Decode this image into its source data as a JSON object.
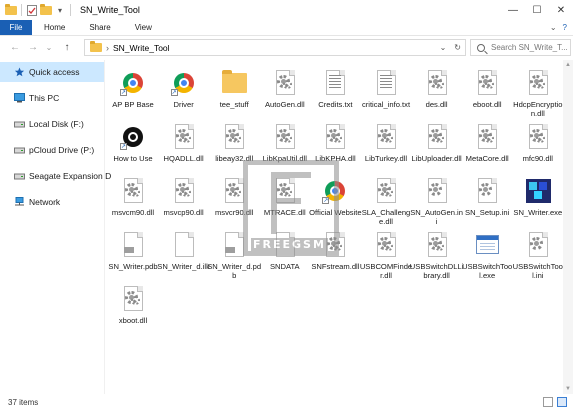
{
  "window": {
    "title": "SN_Write_Tool",
    "minimize": "—",
    "maximize": "☐",
    "close": "✕"
  },
  "ribbon": {
    "file": "File",
    "tabs": [
      "Home",
      "Share",
      "View"
    ],
    "expand": "⌄",
    "help": "?"
  },
  "address": {
    "back": "←",
    "forward": "→",
    "recent": "⌄",
    "up": "↑",
    "chevron": "›",
    "path": "SN_Write_Tool",
    "dropdown": "⌄",
    "refresh": "↻",
    "search_placeholder": "Search SN_Write_T..."
  },
  "nav": {
    "items": [
      {
        "label": "Quick access",
        "icon": "star-icon"
      },
      {
        "label": "This PC",
        "icon": "computer-icon"
      },
      {
        "label": "Local Disk (F:)",
        "icon": "drive-icon"
      },
      {
        "label": "pCloud Drive (P:)",
        "icon": "drive-icon"
      },
      {
        "label": "Seagate Expansion D",
        "icon": "drive-icon"
      },
      {
        "label": "Network",
        "icon": "network-icon"
      }
    ]
  },
  "files": [
    {
      "name": "AP BP Base",
      "icon": "chrome-shortcut-icon"
    },
    {
      "name": "Driver",
      "icon": "chrome-shortcut-icon"
    },
    {
      "name": "tee_stuff",
      "icon": "folder-icon"
    },
    {
      "name": "AutoGen.dll",
      "icon": "dll-icon"
    },
    {
      "name": "Credits.txt",
      "icon": "txt-icon"
    },
    {
      "name": "critical_info.txt",
      "icon": "txt-icon"
    },
    {
      "name": "des.dll",
      "icon": "dll-icon"
    },
    {
      "name": "eboot.dll",
      "icon": "dll-icon"
    },
    {
      "name": "HdcpEncryption.dll",
      "icon": "dll-icon"
    },
    {
      "name": "How to Use",
      "icon": "howto-icon"
    },
    {
      "name": "HQADLL.dll",
      "icon": "dll-icon"
    },
    {
      "name": "libeay32.dll",
      "icon": "dll-icon"
    },
    {
      "name": "LibKpaUtil.dll",
      "icon": "dll-icon"
    },
    {
      "name": "LibKPHA.dll",
      "icon": "dll-icon"
    },
    {
      "name": "LibTurkey.dll",
      "icon": "dll-icon"
    },
    {
      "name": "LibUploader.dll",
      "icon": "dll-icon"
    },
    {
      "name": "MetaCore.dll",
      "icon": "dll-icon"
    },
    {
      "name": "mfc90.dll",
      "icon": "dll-icon"
    },
    {
      "name": "msvcm90.dll",
      "icon": "dll-icon"
    },
    {
      "name": "msvcp90.dll",
      "icon": "dll-icon"
    },
    {
      "name": "msvcr90.dll",
      "icon": "dll-icon"
    },
    {
      "name": "MTRACE.dll",
      "icon": "dll-icon"
    },
    {
      "name": "Official Website",
      "icon": "chrome-shortcut-icon"
    },
    {
      "name": "SLA_Challenge.dll",
      "icon": "dll-icon"
    },
    {
      "name": "SN_AutoGen.ini",
      "icon": "ini-icon"
    },
    {
      "name": "SN_Setup.ini",
      "icon": "ini-icon"
    },
    {
      "name": "SN_Writer.exe",
      "icon": "cube-app-icon"
    },
    {
      "name": "SN_Writer.pdb",
      "icon": "pdb-icon"
    },
    {
      "name": "SN_Writer_d.ilk",
      "icon": "blank-file-icon"
    },
    {
      "name": "SN_Writer_d.pdb",
      "icon": "pdb-icon"
    },
    {
      "name": "SNDATA",
      "icon": "blank-file-icon"
    },
    {
      "name": "SNFstream.dll",
      "icon": "dll-icon"
    },
    {
      "name": "USBCOMFinder.dll",
      "icon": "dll-icon"
    },
    {
      "name": "USBSwitchDLLibrary.dll",
      "icon": "dll-icon"
    },
    {
      "name": "USBSwitchTool.exe",
      "icon": "exe-window-icon"
    },
    {
      "name": "USBSwitchTool.ini",
      "icon": "ini-icon"
    },
    {
      "name": "xboot.dll",
      "icon": "dll-icon"
    }
  ],
  "watermark": {
    "text": "FREEGSM"
  },
  "status": {
    "count": "37 items"
  },
  "colors": {
    "file_tab": "#1a5fb4",
    "selected_nav": "#cce8ff",
    "folder": "#f6c760"
  }
}
